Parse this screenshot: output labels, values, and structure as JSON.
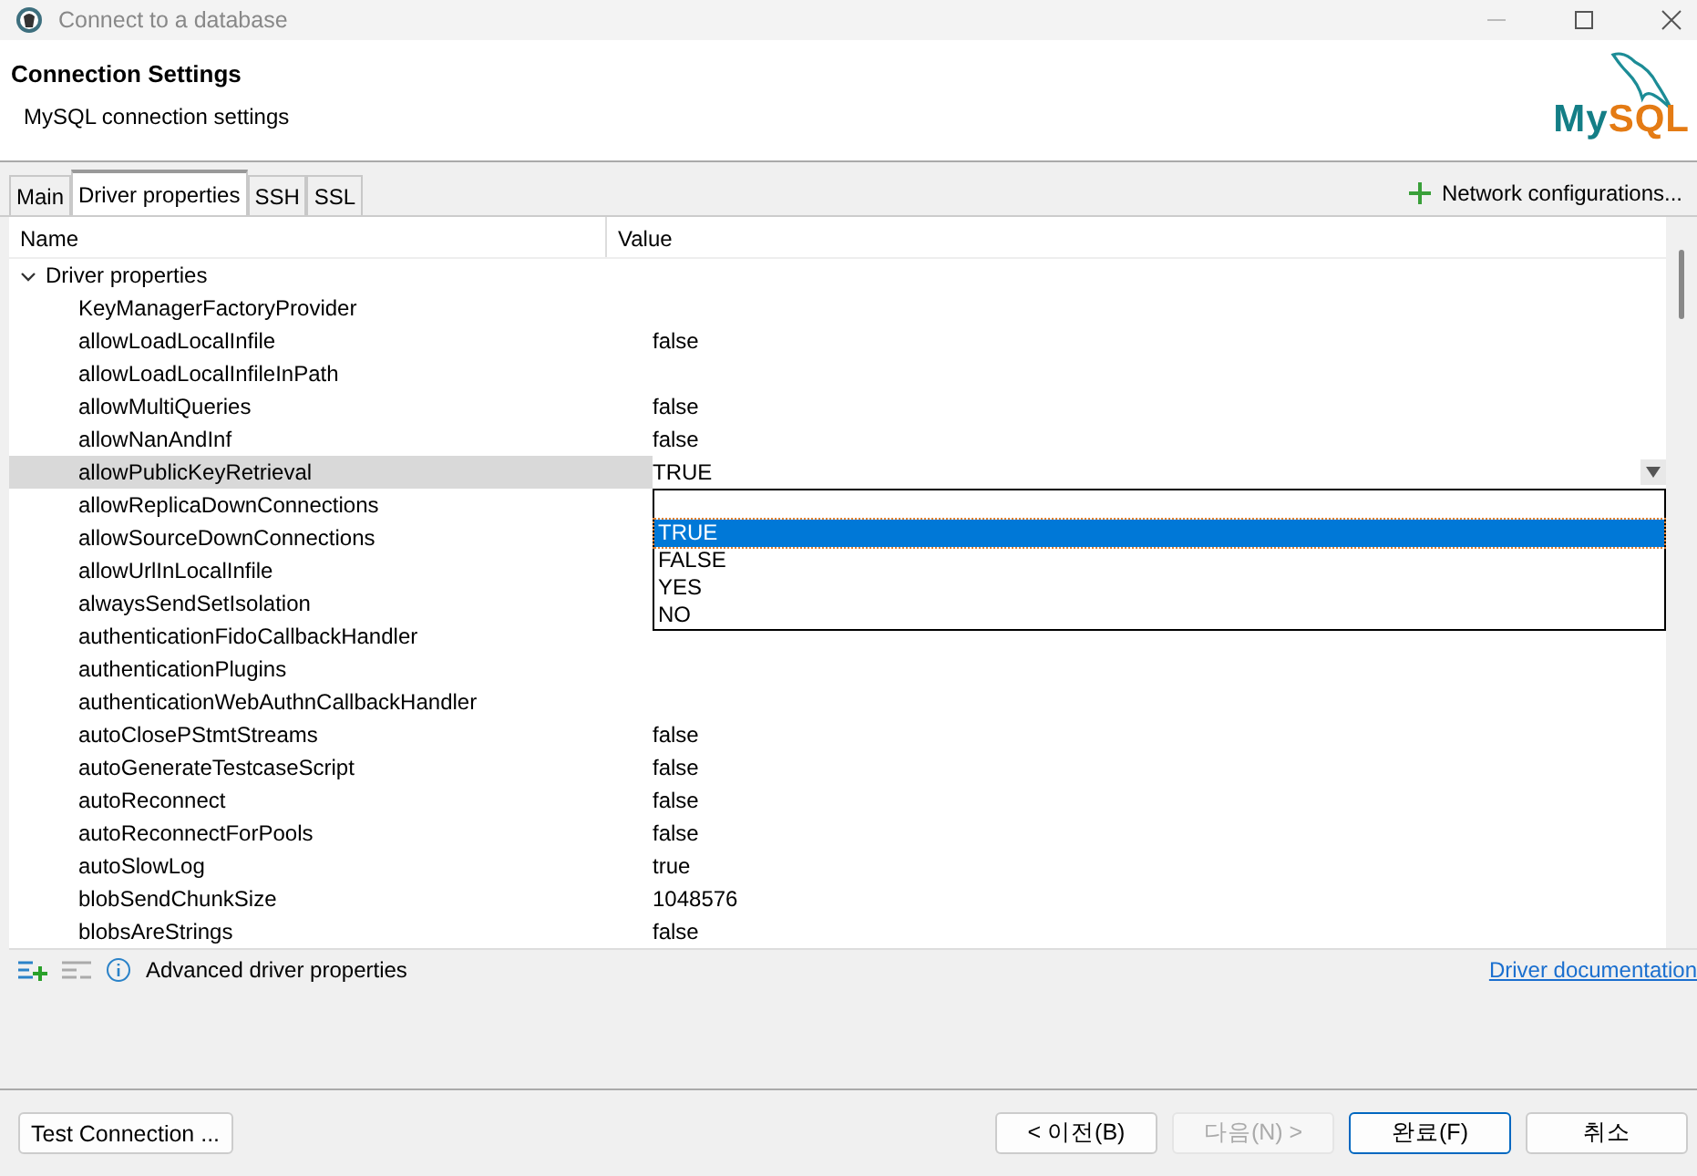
{
  "window": {
    "title": "Connect to a database"
  },
  "header": {
    "title": "Connection Settings",
    "subtitle": "MySQL connection settings",
    "logo": {
      "first": "My",
      "second": "SQL"
    }
  },
  "tabs": [
    {
      "label": "Main",
      "selected": false
    },
    {
      "label": "Driver properties",
      "selected": true
    },
    {
      "label": "SSH",
      "selected": false
    },
    {
      "label": "SSL",
      "selected": false
    }
  ],
  "network_button": "Network configurations...",
  "table": {
    "columns": [
      "Name",
      "Value"
    ],
    "groups": [
      {
        "label": "Driver properties",
        "expanded": true,
        "children": [
          {
            "name": "KeyManagerFactoryProvider",
            "selected": false,
            "kind": "text"
          },
          {
            "name": "allowLoadLocalInfile",
            "value": "false",
            "selected": false,
            "kind": "text"
          },
          {
            "name": "allowLoadLocalInfileInPath",
            "selected": false,
            "kind": "text"
          },
          {
            "name": "allowMultiQueries",
            "value": "false",
            "selected": false,
            "kind": "text"
          },
          {
            "name": "allowNanAndInf",
            "value": "false",
            "selected": false,
            "kind": "text"
          },
          {
            "name": "allowPublicKeyRetrieval",
            "value": "TRUE",
            "selected": true,
            "kind": "combo",
            "options": [
              {
                "label": "TRUE",
                "selected": true
              },
              {
                "label": "FALSE",
                "selected": false
              },
              {
                "label": "YES",
                "selected": false
              },
              {
                "label": "NO",
                "selected": false
              }
            ]
          },
          {
            "name": "allowReplicaDownConnections",
            "selected": false,
            "kind": "text"
          },
          {
            "name": "allowSourceDownConnections",
            "selected": false,
            "kind": "text"
          },
          {
            "name": "allowUrlInLocalInfile",
            "selected": false,
            "kind": "text"
          },
          {
            "name": "alwaysSendSetIsolation",
            "selected": false,
            "kind": "text"
          },
          {
            "name": "authenticationFidoCallbackHandler",
            "selected": false,
            "kind": "text"
          },
          {
            "name": "authenticationPlugins",
            "selected": false,
            "kind": "text"
          },
          {
            "name": "authenticationWebAuthnCallbackHandler",
            "selected": false,
            "kind": "text"
          },
          {
            "name": "autoClosePStmtStreams",
            "value": "false",
            "selected": false,
            "kind": "text"
          },
          {
            "name": "autoGenerateTestcaseScript",
            "value": "false",
            "selected": false,
            "kind": "text"
          },
          {
            "name": "autoReconnect",
            "value": "false",
            "selected": false,
            "kind": "text"
          },
          {
            "name": "autoReconnectForPools",
            "value": "false",
            "selected": false,
            "kind": "text"
          },
          {
            "name": "autoSlowLog",
            "value": "true",
            "selected": false,
            "kind": "text"
          },
          {
            "name": "blobSendChunkSize",
            "value": "1048576",
            "selected": false,
            "kind": "text"
          },
          {
            "name": "blobsAreStrings",
            "value": "false",
            "selected": false,
            "kind": "text"
          }
        ]
      }
    ]
  },
  "toolbar": {
    "info": "Advanced driver properties",
    "link": "Driver documentation"
  },
  "buttons": [
    {
      "label": "Test Connection ...",
      "kind": "normal",
      "disabled": false
    },
    {
      "label": "< 이전(B)",
      "kind": "normal",
      "disabled": false
    },
    {
      "label": "다음(N) >",
      "kind": "normal",
      "disabled": true
    },
    {
      "label": "완료(F)",
      "kind": "default",
      "disabled": false
    },
    {
      "label": "취소",
      "kind": "normal",
      "disabled": false
    }
  ]
}
